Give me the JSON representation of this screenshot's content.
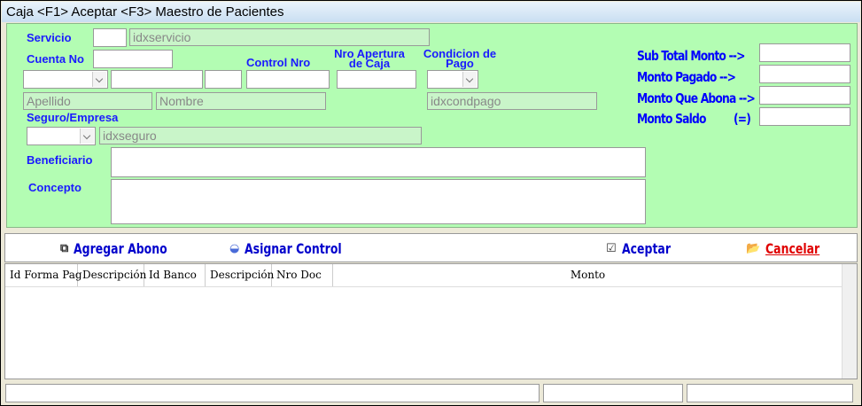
{
  "window": {
    "title": "Caja <F1> Aceptar <F3> Maestro de Pacientes"
  },
  "form": {
    "servicio_label": "Servicio",
    "servicio_value": "",
    "servicio_desc": "idxservicio",
    "cuenta_label": "Cuenta No",
    "cuenta_value": "",
    "control_label": "Control Nro",
    "nro_apertura_label_1": "Nro Apertura",
    "nro_apertura_label_2": "de Caja",
    "condicion_label_1": "Condicion de",
    "condicion_label_2": "Pago",
    "apellido_placeholder": "Apellido",
    "nombre_placeholder": "Nombre",
    "condpago_desc": "idxcondpago",
    "seguro_label": "Seguro/Empresa",
    "seguro_desc": "idxseguro",
    "beneficiario_label": "Beneficiario",
    "concepto_label": "Concepto"
  },
  "totals": {
    "subtotal_label": "Sub Total Monto -->",
    "pagado_label": "Monto Pagado -->",
    "abona_label": "Monto  Que Abona -->",
    "saldo_label": "Monto Saldo",
    "saldo_suffix": "(=)"
  },
  "toolbar": {
    "agregar_label": "Agregar Abono",
    "asignar_label": "Asignar Control",
    "aceptar_label": "Aceptar",
    "cancelar_label": "Cancelar"
  },
  "grid": {
    "columns": [
      "Id Forma Pag",
      "Descripción",
      "Id Banco",
      "Descripción",
      "Nro Doc",
      "Monto"
    ]
  },
  "colors": {
    "panel": "#b3fdb3",
    "label": "#1a1aff",
    "cancel": "#e00000"
  }
}
